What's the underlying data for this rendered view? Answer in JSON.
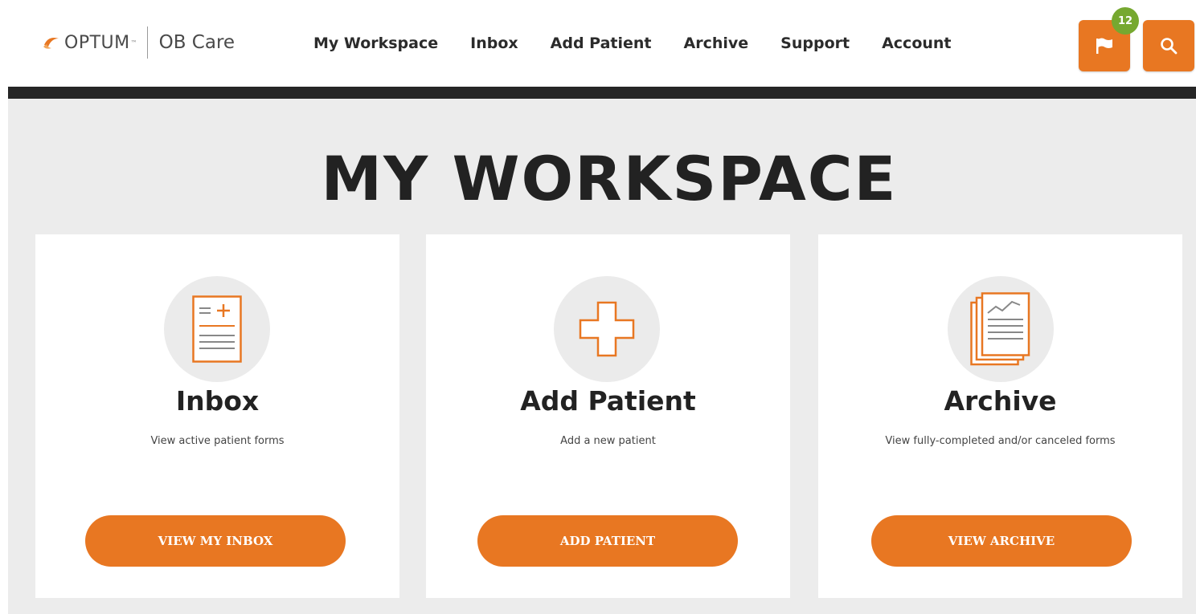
{
  "header": {
    "brand": "OPTUM",
    "brand_tm": "™",
    "product": "OB Care",
    "nav": [
      "My Workspace",
      "Inbox",
      "Add Patient",
      "Archive",
      "Support",
      "Account"
    ],
    "notification_count": "12",
    "icons": {
      "flag": "flag-icon",
      "search": "search-icon"
    }
  },
  "page": {
    "title": "MY WORKSPACE"
  },
  "cards": [
    {
      "title": "Inbox",
      "description": "View active patient forms",
      "button": "VIEW MY INBOX",
      "icon": "form-document-icon"
    },
    {
      "title": "Add Patient",
      "description": "Add a new patient",
      "button": "ADD PATIENT",
      "icon": "medical-cross-icon"
    },
    {
      "title": "Archive",
      "description": "View fully-completed and/or canceled forms",
      "button": "VIEW ARCHIVE",
      "icon": "archive-documents-icon"
    }
  ],
  "colors": {
    "accent": "#e87722",
    "badge": "#76a830",
    "dark_bar": "#262626",
    "background": "#ececec"
  }
}
